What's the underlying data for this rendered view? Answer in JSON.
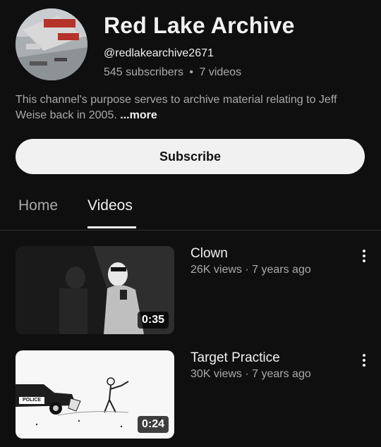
{
  "channel": {
    "title": "Red Lake Archive",
    "handle": "@redlakearchive2671",
    "subscribers": "545 subscribers",
    "separator": "•",
    "videos_count": "7 videos",
    "description": "This channel's purpose serves to archive material relating to Jeff Weise back in 2005.",
    "more_label": "...more"
  },
  "subscribe_label": "Subscribe",
  "tabs": [
    {
      "label": "Home",
      "active": false
    },
    {
      "label": "Videos",
      "active": true
    }
  ],
  "videos": [
    {
      "title": "Clown",
      "meta": "26K views · 7 years ago",
      "duration": "0:35"
    },
    {
      "title": "Target Practice",
      "meta": "30K views · 7 years ago",
      "duration": "0:24",
      "thumb_text": "POLICE"
    }
  ],
  "colors": {
    "background": "#0f0f0f",
    "text": "#f1f1f1",
    "secondary": "#aaaaaa",
    "button": "#f1f1f1"
  }
}
